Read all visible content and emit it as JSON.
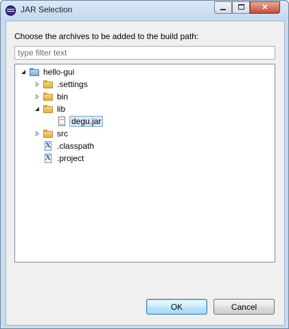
{
  "window": {
    "title": "JAR Selection"
  },
  "dialog": {
    "instruction": "Choose the archives to be added to the build path:",
    "filter_placeholder": "type filter text",
    "filter_value": ""
  },
  "tree": {
    "root": {
      "label": "hello-gui",
      "expanded": true,
      "icon": "project-folder-icon"
    },
    "items": [
      {
        "label": ".settings",
        "icon": "folder-icon",
        "expandable": true,
        "expanded": false
      },
      {
        "label": "bin",
        "icon": "folder-icon",
        "expandable": true,
        "expanded": false
      },
      {
        "label": "lib",
        "icon": "folder-icon",
        "expandable": true,
        "expanded": true
      },
      {
        "label": "degu.jar",
        "icon": "jar-file-icon",
        "selected": true
      },
      {
        "label": "src",
        "icon": "folder-icon",
        "expandable": true,
        "expanded": false
      },
      {
        "label": ".classpath",
        "icon": "xml-file-icon"
      },
      {
        "label": ".project",
        "icon": "xml-file-icon"
      }
    ]
  },
  "buttons": {
    "ok": "OK",
    "cancel": "Cancel"
  }
}
